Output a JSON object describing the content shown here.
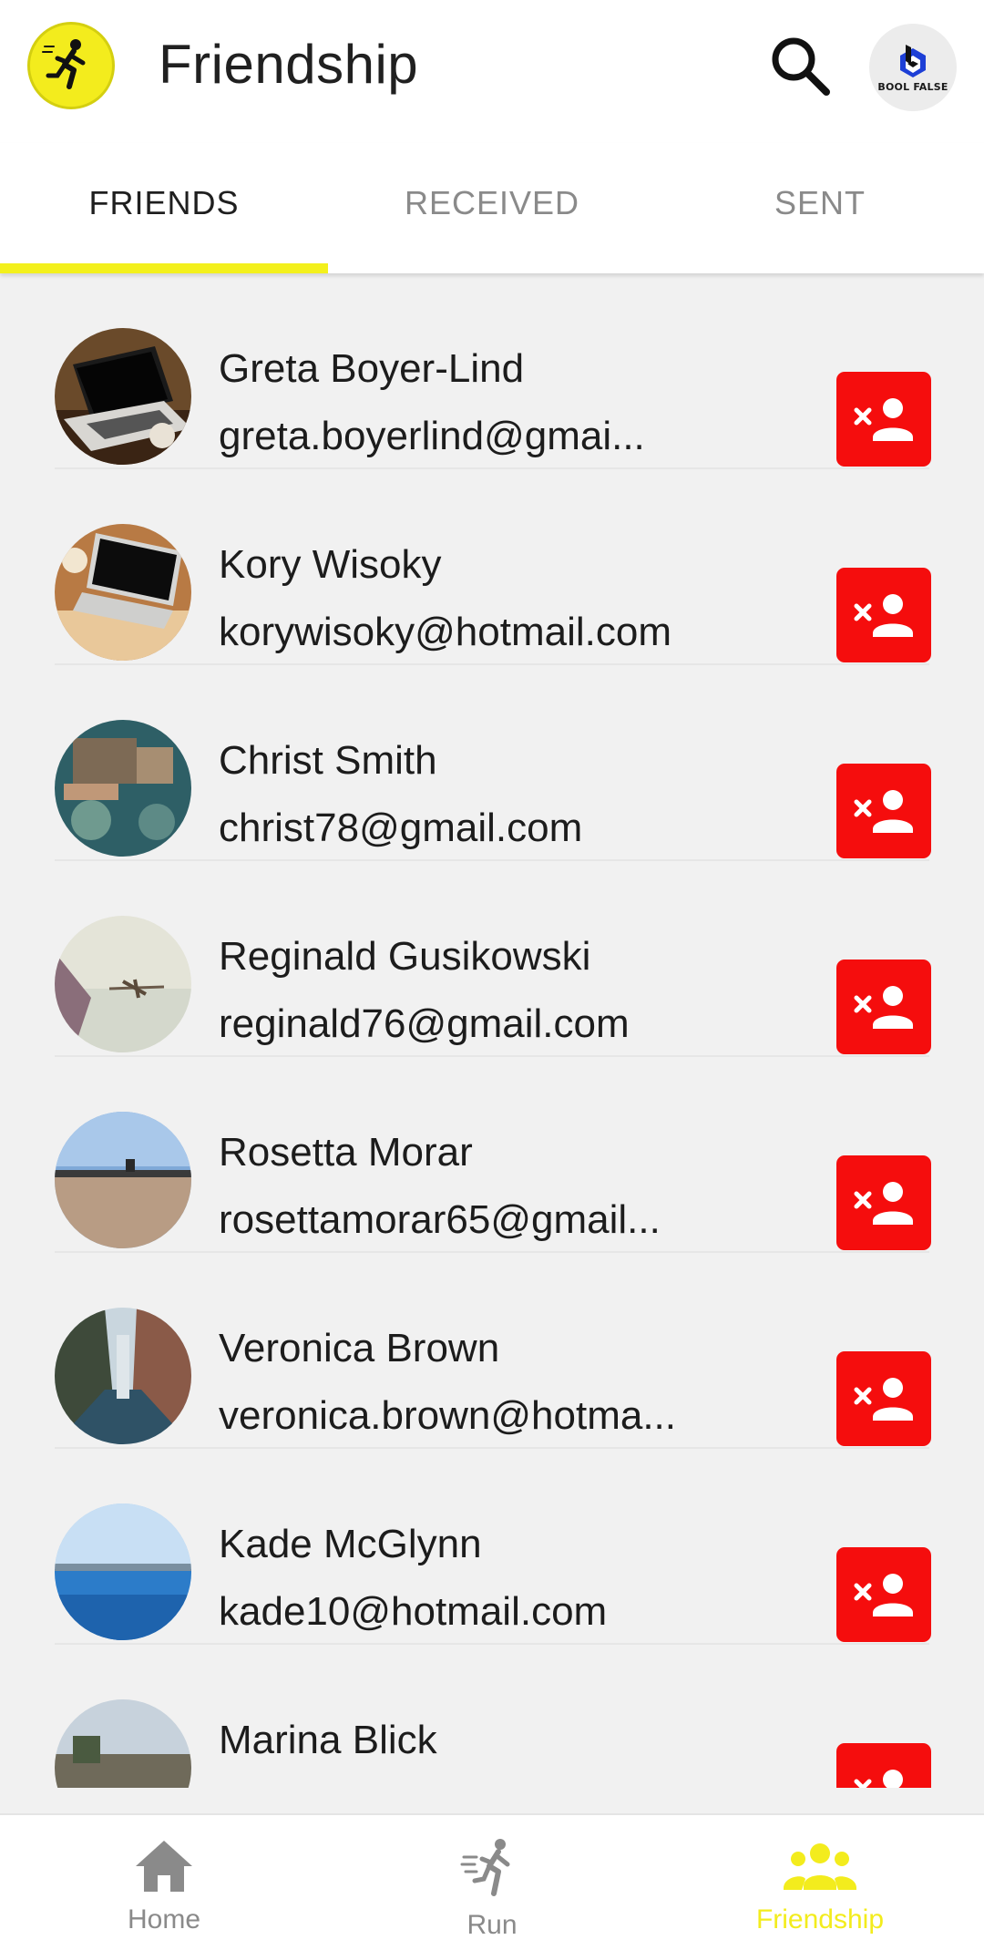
{
  "header": {
    "title": "Friendship",
    "logo_icon": "runner-logo-icon",
    "search_icon": "search-icon",
    "profile_brand_text": "BOOL FALSE"
  },
  "tabs": [
    {
      "label": "FRIENDS",
      "active": true
    },
    {
      "label": "RECEIVED",
      "active": false
    },
    {
      "label": "SENT",
      "active": false
    }
  ],
  "friends": [
    {
      "name": "Greta Boyer-Lind",
      "email": "greta.boyerlind@gmai..."
    },
    {
      "name": "Kory Wisoky",
      "email": "korywisoky@hotmail.com"
    },
    {
      "name": "Christ Smith",
      "email": "christ78@gmail.com"
    },
    {
      "name": "Reginald Gusikowski",
      "email": "reginald76@gmail.com"
    },
    {
      "name": "Rosetta Morar",
      "email": "rosettamorar65@gmail..."
    },
    {
      "name": "Veronica Brown",
      "email": "veronica.brown@hotma..."
    },
    {
      "name": "Kade McGlynn",
      "email": "kade10@hotmail.com"
    },
    {
      "name": "Marina Blick",
      "email": ""
    }
  ],
  "bottom_nav": [
    {
      "label": "Home",
      "icon": "home-icon",
      "active": false
    },
    {
      "label": "Run",
      "icon": "running-icon",
      "active": false
    },
    {
      "label": "Friendship",
      "icon": "group-icon",
      "active": true
    }
  ],
  "colors": {
    "accent_yellow": "#f3f01c",
    "remove_red": "#f50d0d",
    "inactive_gray": "#8a8a8a"
  }
}
